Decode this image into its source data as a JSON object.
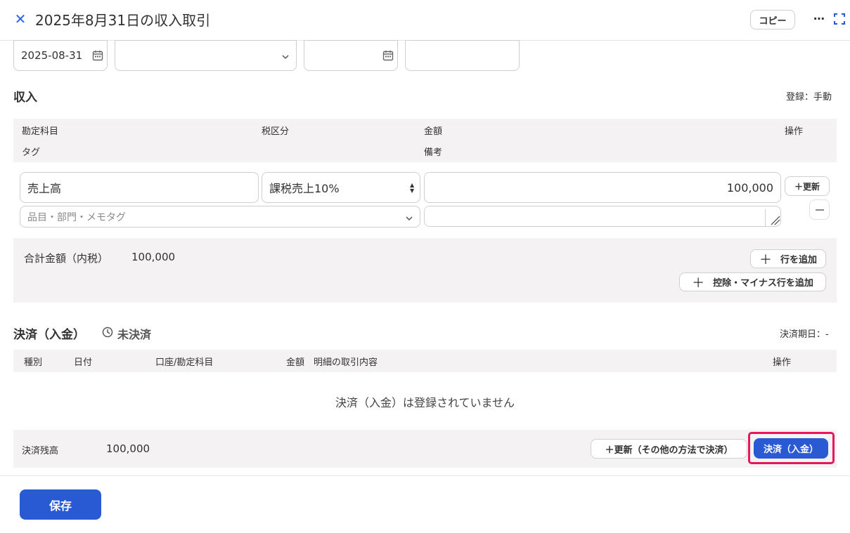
{
  "header": {
    "title": "2025年8月31日の収入取引",
    "copy_label": "コピー",
    "more_icon": "more-horizontal-icon",
    "expand_icon": "expand-icon",
    "close_icon": "close-icon"
  },
  "top_fields": {
    "date_value": "2025-08-31",
    "partner_value": "",
    "due_date_value": "",
    "memo_value": ""
  },
  "income": {
    "title": "収入",
    "registration": "登録：手動",
    "headers": {
      "account": "勘定科目",
      "tax": "税区分",
      "amount": "金額",
      "operation": "操作",
      "tag": "タグ",
      "remarks": "備考"
    },
    "row": {
      "account": "売上高",
      "tax": "課税売上10%",
      "amount": "100,000",
      "update_label": "＋更新",
      "tag_placeholder": "品目・部門・メモタグ",
      "remarks": ""
    },
    "total_label": "合計金額（内税）",
    "total_value": "100,000",
    "add_row_label": "行を追加",
    "add_deduction_label": "控除・マイナス行を追加"
  },
  "settlement": {
    "title": "決済（入金）",
    "status": "未決済",
    "date_label": "決済期日：-",
    "headers": {
      "type": "種別",
      "date": "日付",
      "account": "口座/勘定科目",
      "amount": "金額",
      "details": "明細の取引内容",
      "operation": "操作"
    },
    "empty_message": "決済（入金）は登録されていません",
    "balance_label": "決済残高",
    "balance_value": "100,000",
    "update_other_label": "＋更新（その他の方法で決済）",
    "settle_label": "決済（入金）"
  },
  "footer": {
    "save_label": "保存"
  },
  "colors": {
    "accent": "#2a5ad3",
    "highlight": "#e8175d",
    "band": "#f4f2f2"
  }
}
